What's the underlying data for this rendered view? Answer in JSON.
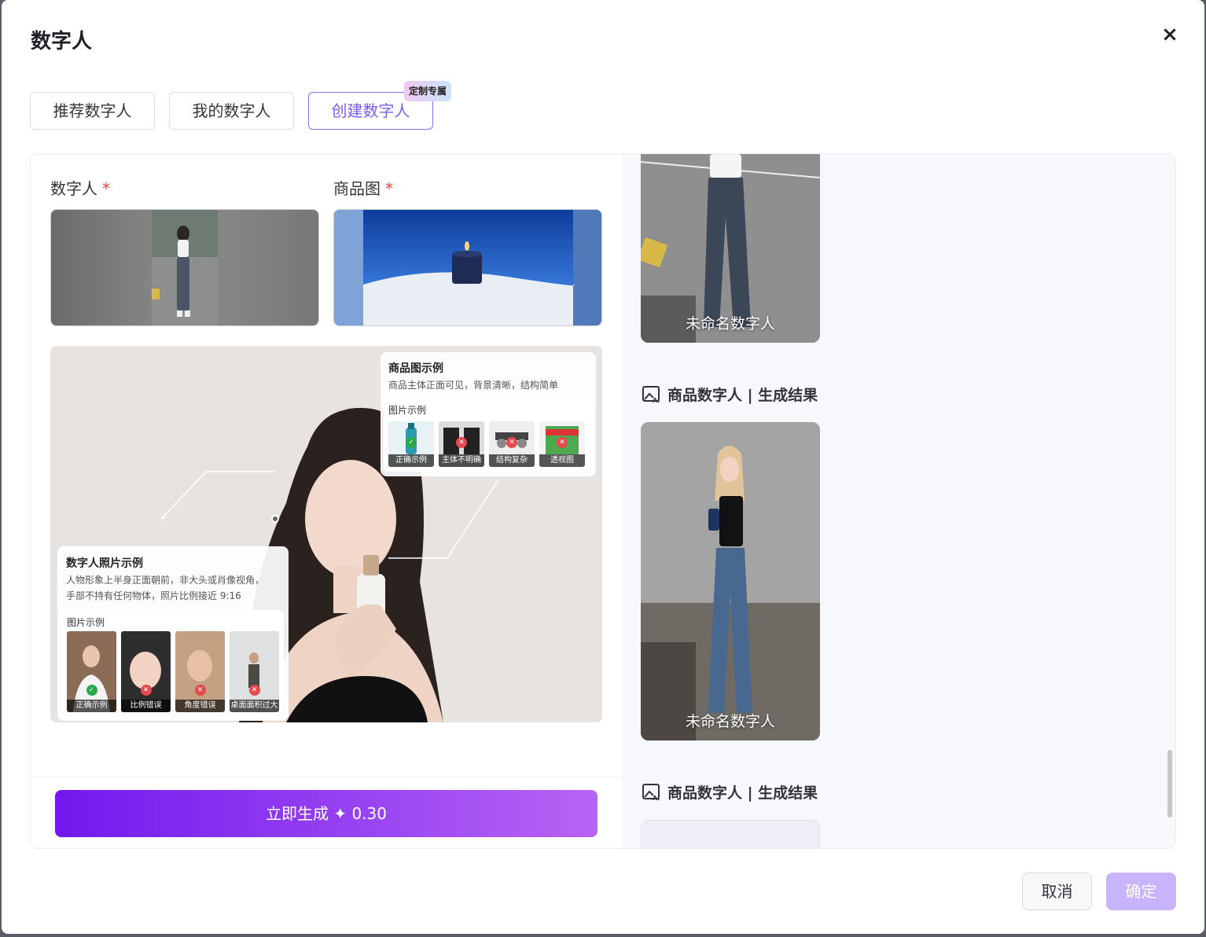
{
  "dialog": {
    "title": "数字人",
    "close_icon": "×"
  },
  "tabs": [
    {
      "label": "推荐数字人",
      "active": false
    },
    {
      "label": "我的数字人",
      "active": false
    },
    {
      "label": "创建数字人",
      "active": true
    }
  ],
  "badge": "定制专属",
  "form": {
    "digital_human_label": "数字人",
    "product_image_label": "商品图",
    "required_mark": "*"
  },
  "product_example": {
    "title": "商品图示例",
    "desc": "商品主体正面可见，背景清晰，结构简单",
    "images_label": "图片示例",
    "items": [
      {
        "caption": "正确示例",
        "status": "ok"
      },
      {
        "caption": "主体不明确",
        "status": "bad"
      },
      {
        "caption": "结构复杂",
        "status": "bad"
      },
      {
        "caption": "透视图",
        "status": "bad"
      }
    ]
  },
  "human_example": {
    "title": "数字人照片示例",
    "desc_line1": "人物形象上半身正面朝前，非大头或肖像视角，",
    "desc_line2": "手部不持有任何物体，照片比例接近 9:16",
    "images_label": "图片示例",
    "items": [
      {
        "caption": "正确示例",
        "status": "ok"
      },
      {
        "caption": "比例错误",
        "status": "bad"
      },
      {
        "caption": "角度错误",
        "status": "bad"
      },
      {
        "caption": "桌面面积过大",
        "status": "bad"
      }
    ]
  },
  "generate_button": "立即生成 ✦ 0.30",
  "results": {
    "section_title": "商品数字人 | 生成结果",
    "item_name": "未命名数字人"
  },
  "footer": {
    "cancel": "取消",
    "confirm": "确定"
  },
  "colors": {
    "accent": "#7b5df2",
    "button_gradient_start": "#7119ee",
    "button_gradient_end": "#b664f5",
    "confirm_disabled": "#c8b4fb"
  }
}
